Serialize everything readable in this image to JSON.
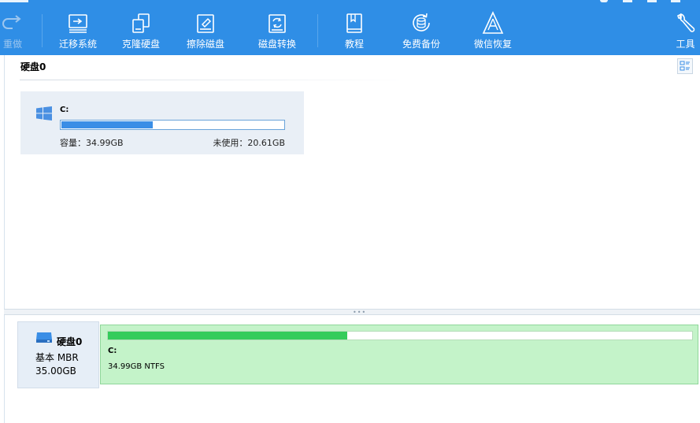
{
  "toolbar": {
    "items": [
      {
        "label": "重做",
        "icon": "redo-icon",
        "enabled": false
      },
      {
        "label": "迁移系统",
        "icon": "migrate-os-icon",
        "enabled": true
      },
      {
        "label": "克隆硬盘",
        "icon": "clone-disk-icon",
        "enabled": true
      },
      {
        "label": "擦除磁盘",
        "icon": "wipe-disk-icon",
        "enabled": true
      },
      {
        "label": "磁盘转换",
        "icon": "convert-disk-icon",
        "enabled": true
      },
      {
        "label": "教程",
        "icon": "tutorial-book-icon",
        "enabled": true
      },
      {
        "label": "免费备份",
        "icon": "free-backup-icon",
        "enabled": true
      },
      {
        "label": "微信恢复",
        "icon": "wechat-recovery-icon",
        "enabled": true
      },
      {
        "label": "工具",
        "icon": "tools-wrench-icon",
        "enabled": true
      }
    ]
  },
  "disk_panel": {
    "title": "硬盘0",
    "partition": {
      "name": "C:",
      "used_fraction": 0.41,
      "capacity": "容量：34.99GB",
      "unused": "未使用：20.61GB"
    }
  },
  "disk_map": {
    "disk_name": "硬盘0",
    "disk_type": "基本 MBR",
    "disk_size": "35.00GB",
    "partition": {
      "name": "C:",
      "used_fraction": 0.41,
      "info": "34.99GB NTFS"
    }
  },
  "colors": {
    "toolbar_bg": "#2f8ee6",
    "partition_bar": "#3a8ee6",
    "map_partition_bg": "#c4f3c9",
    "map_partition_bar": "#34cc5b"
  }
}
